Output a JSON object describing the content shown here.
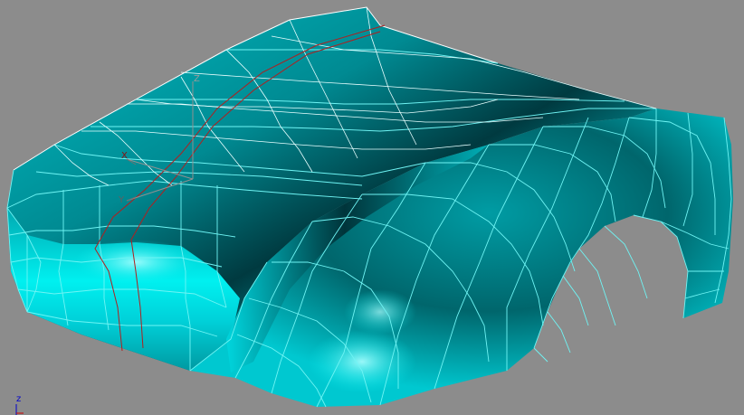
{
  "viewport": {
    "background_color": "#8c8c8c",
    "mesh_color": "#00d8d8",
    "wire_color": "#5ff5f5",
    "edge_color": "#ffffff",
    "spline_color": "#b02020",
    "gizmo_color": "#909090"
  },
  "gizmo": {
    "x_label": "X",
    "y_label": "Y",
    "z_label": "Z"
  },
  "world_axis": {
    "z_label": "z",
    "x_label": "x"
  }
}
